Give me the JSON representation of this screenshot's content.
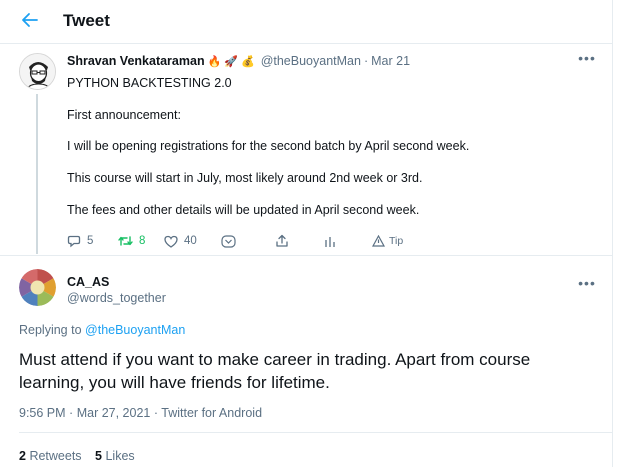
{
  "header": {
    "title": "Tweet",
    "back_icon": "arrow-left-icon",
    "accent": "#1da1f2"
  },
  "parent_tweet": {
    "author_name": "Shravan Venkataraman",
    "author_emojis": [
      "🔥",
      "🚀",
      "💰"
    ],
    "handle": "@theBuoyantMan",
    "separator": "·",
    "date": "Mar 21",
    "more_icon": "more-dots-icon",
    "body_lines": [
      "PYTHON BACKTESTING 2.0",
      "First announcement:",
      "I will be opening registrations for the second batch by April second week.",
      "This course will start in July, most likely around 2nd week or 3rd.",
      "The fees and other details will be updated in April second week."
    ],
    "actions": {
      "reply_count": "5",
      "retweet_count": "8",
      "like_count": "40",
      "tip_label": "Tip"
    },
    "retweet_color": "#17bf63"
  },
  "reply_tweet": {
    "author_name": "CA_AS",
    "handle": "@words_together",
    "replying_prefix": "Replying to",
    "replying_to": "@theBuoyantMan",
    "text": "Must attend if you want to make career in trading. Apart from course learning, you will have friends for lifetime.",
    "time": "9:56 PM",
    "separator": "·",
    "date": "Mar 27, 2021",
    "source": "Twitter for Android",
    "retweets_count": "2",
    "retweets_label": "Retweets",
    "likes_count": "5",
    "likes_label": "Likes"
  }
}
